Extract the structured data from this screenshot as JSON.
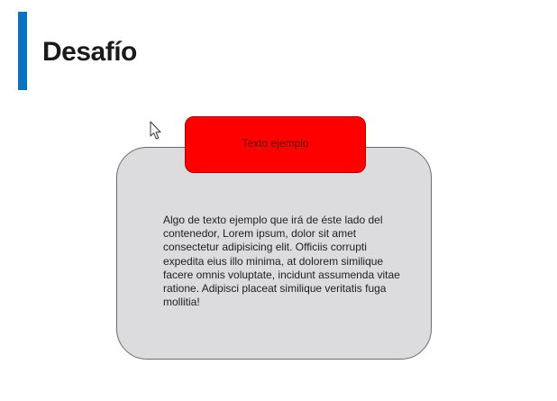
{
  "slide": {
    "title": "Desafío",
    "accent_color": "#0a72c2"
  },
  "card": {
    "tab_label": "Texto ejemplo",
    "tab_color": "#ff0000",
    "background_color": "#dcdcdf",
    "body_text": "Algo de texto ejemplo que irá de éste lado del contenedor, Lorem ipsum, dolor sit amet consectetur adipisicing elit. Officiis corrupti expedita eius illo minima, at dolorem similique facere omnis voluptate, incidunt assumenda vitae ratione. Adipisci placeat similique veritatis fuga mollitia!"
  },
  "cursor": {
    "icon": "arrow-cursor-icon"
  }
}
